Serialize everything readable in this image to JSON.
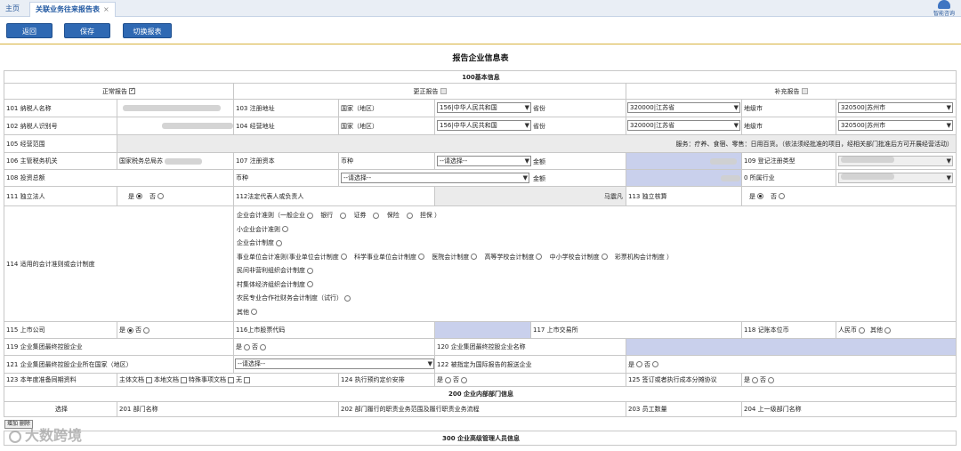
{
  "tabs": {
    "home": "主页",
    "active": "关联业务往来报告表",
    "close": "×"
  },
  "helper": "智能咨询",
  "toolbar": {
    "back": "返回",
    "save": "保存",
    "switch": "切换报表"
  },
  "title": "报告企业信息表",
  "sec100": "100基本信息",
  "report_types": {
    "normal": "正常报告",
    "changed": "更正报告",
    "supplement": "补充报告"
  },
  "r101": {
    "label": "101 纳税人名称",
    "addr_label": "103 注册地址",
    "country_label": "国家（地区）",
    "country": "156|中华人民共和国",
    "province_label": "省份",
    "province": "320000|江苏省",
    "city_label": "地级市",
    "city": "320500|苏州市"
  },
  "r102": {
    "label": "102 纳税人识别号",
    "addr_label": "104 经营地址",
    "country_label": "国家（地区）",
    "country": "156|中华人民共和国",
    "province_label": "省份",
    "province": "320000|江苏省",
    "city_label": "地级市",
    "city": "320500|苏州市"
  },
  "r105": {
    "label": "105 经营范围",
    "text": "服务：疗养、食宿、零售：日用百货。（依法须经批准的项目，经相关部门批准后方可开展经营活动）"
  },
  "r106": {
    "label": "106 主管税务机关",
    "value": "国家税务总局苏",
    "capital_label": "107 注册资本",
    "currency_label": "币种",
    "currency": "--请选择--",
    "amount_label": "金额",
    "regtype_label": "109 登记注册类型"
  },
  "r108": {
    "label": "108 投资总额",
    "currency_label": "币种",
    "currency": "--请选择--",
    "amount_label": "金额",
    "industry_label": "0 所属行业"
  },
  "r111": {
    "label": "111 独立法人",
    "yes": "是",
    "no": "否",
    "rep_label": "112法定代表人或负责人",
    "rep_value": "马震凡",
    "acct_label": "113 独立核算"
  },
  "r114": {
    "label": "114 适用的会计准则或会计制度",
    "l1": "企业会计准则（一般企业",
    "l1_opts": [
      "银行",
      "证券",
      "保险",
      "担保 ）"
    ],
    "l2": "小企业会计准则",
    "l3": "企业会计制度",
    "l4": "事业单位会计准则(事业单位会计制度",
    "l4_opts": [
      "科学事业单位会计制度",
      "医院会计制度",
      "高等学校会计制度",
      "中小学校会计制度",
      "彩票机构会计制度 ）"
    ],
    "l5": "民间非营利组织会计制度",
    "l6": "村集体经济组织会计制度",
    "l7": "农民专业合作社财务会计制度（试行）",
    "l8": "其他"
  },
  "r115": {
    "label": "115 上市公司",
    "yes": "是",
    "no": "否",
    "code_label": "116上市股票代码",
    "exch_label": "117 上市交易所",
    "cur_label": "118 记账本位币",
    "rmb": "人民币",
    "other": "其他"
  },
  "r119": {
    "label": "119 企业集团最终控股企业",
    "yes": "是",
    "no": "否",
    "name_label": "120 企业集团最终控股企业名称"
  },
  "r121": {
    "label": "121 企业集团最终控股企业所在国家（地区）",
    "select": "--请选择--",
    "r122_label": "122 被指定为国际报告的报送企业",
    "yes": "是",
    "no": "否"
  },
  "r123": {
    "label": "123 本年度准备同期资料",
    "docs": [
      "主体文档",
      "本地文档",
      "特殊事项文档",
      "无"
    ],
    "r124_label": "124 执行预约定价安排",
    "yes": "是",
    "no": "否",
    "r125_label": "125 签订或者执行成本分摊协议"
  },
  "sec200": "200 企业内部部门信息",
  "sec200_cols": [
    "选择",
    "201 部门名称",
    "202 部门履行的职责业务范围及履行职责业务流程",
    "203 员工数量",
    "204 上一级部门名称"
  ],
  "small_buttons": "增加 删除",
  "sec300": "300 企业高级管理人员信息",
  "watermark": "大数跨境"
}
